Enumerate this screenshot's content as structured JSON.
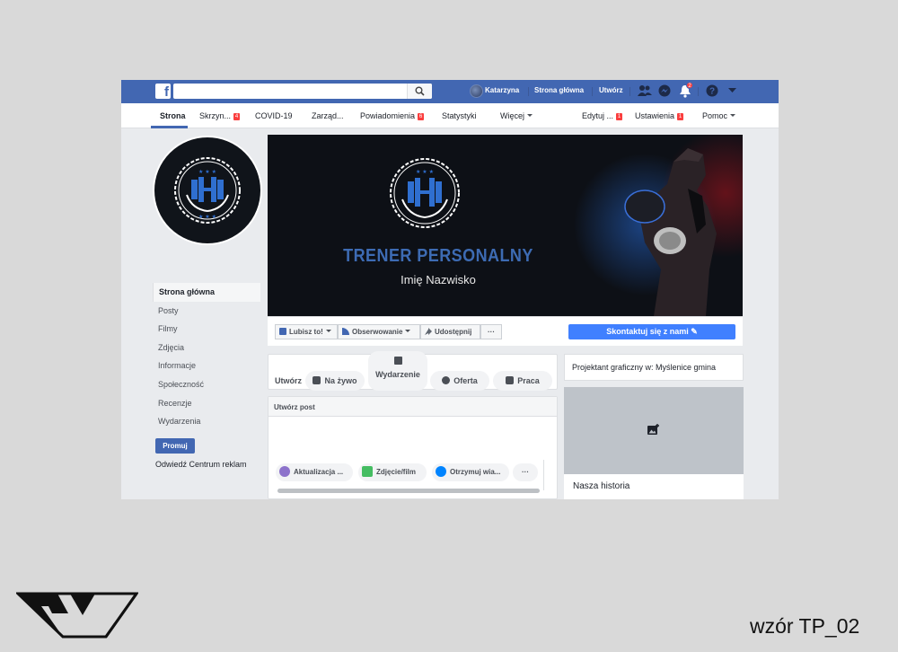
{
  "topbar": {
    "logo": "f",
    "user_name": "Katarzyna",
    "home_label": "Strona główna",
    "create_label": "Utwórz",
    "notifications_count": "2"
  },
  "page_tabs": [
    {
      "label": "Strona",
      "badge": ""
    },
    {
      "label": "Skrzyn...",
      "badge": "4"
    },
    {
      "label": "COVID-19",
      "badge": ""
    },
    {
      "label": "Zarząd...",
      "badge": ""
    },
    {
      "label": "Powiadomienia",
      "badge": "6"
    },
    {
      "label": "Statystyki",
      "badge": ""
    },
    {
      "label": "Więcej",
      "badge": ""
    },
    {
      "label": "Edytuj ...",
      "badge": "1"
    },
    {
      "label": "Ustawienia",
      "badge": "1"
    },
    {
      "label": "Pomoc",
      "badge": ""
    }
  ],
  "left_nav": [
    "Strona główna",
    "Posty",
    "Filmy",
    "Zdjęcia",
    "Informacje",
    "Społeczność",
    "Recenzje",
    "Wydarzenia"
  ],
  "promote_label": "Promuj",
  "ads_center_label": "Odwiedź Centrum reklam",
  "cover": {
    "title": "TRENER PERSONALNY",
    "subtitle": "Imię Nazwisko"
  },
  "actions": {
    "like": "Lubisz to!",
    "follow": "Obserwowanie",
    "share": "Udostępnij",
    "more": "···",
    "contact": "Skontaktuj się z nami"
  },
  "create_strip": {
    "label": "Utwórz",
    "items": [
      "Na żywo",
      "Wydarzenie",
      "Oferta",
      "Praca"
    ]
  },
  "create_post": {
    "header": "Utwórz post",
    "options": [
      "Aktualizacja ...",
      "Zdjęcie/film",
      "Otrzymuj wia...",
      "···"
    ]
  },
  "right_column": {
    "category": "Projektant graficzny w: Myślenice gmina",
    "story": "Nasza historia"
  },
  "footer_label": "wzór TP_02",
  "colors": {
    "facebook_blue": "#4267b2",
    "contact_button": "#4080ff",
    "cover_title": "#3d6bb3",
    "badge_red": "#fa3e3e"
  }
}
